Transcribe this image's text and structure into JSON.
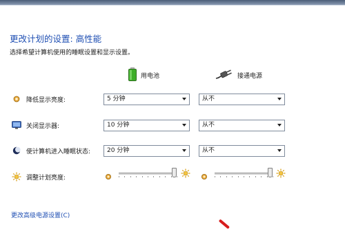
{
  "header": {
    "title": "更改计划的设置: 高性能",
    "subtitle": "选择希望计算机使用的睡眠设置和显示设置。"
  },
  "columns": {
    "battery_label": "用电池",
    "plugged_label": "接通电源"
  },
  "settings": [
    {
      "label": "降低显示亮度:",
      "icon": "dim-brightness-icon",
      "battery": "5 分钟",
      "plugged": "从不"
    },
    {
      "label": "关闭显示器:",
      "icon": "monitor-icon",
      "battery": "10 分钟",
      "plugged": "从不"
    },
    {
      "label": "使计算机进入睡眠状态:",
      "icon": "sleep-moon-icon",
      "battery": "20 分钟",
      "plugged": "从不"
    }
  ],
  "brightness": {
    "label": "调整计划亮度:",
    "battery_level": 0.95,
    "plugged_level": 0.95
  },
  "links": {
    "advanced": "更改高级电源设置(C)"
  },
  "colors": {
    "link": "#1f4fb3",
    "battery_green": "#3fae2a",
    "accent_mark": "#d71d1d"
  }
}
